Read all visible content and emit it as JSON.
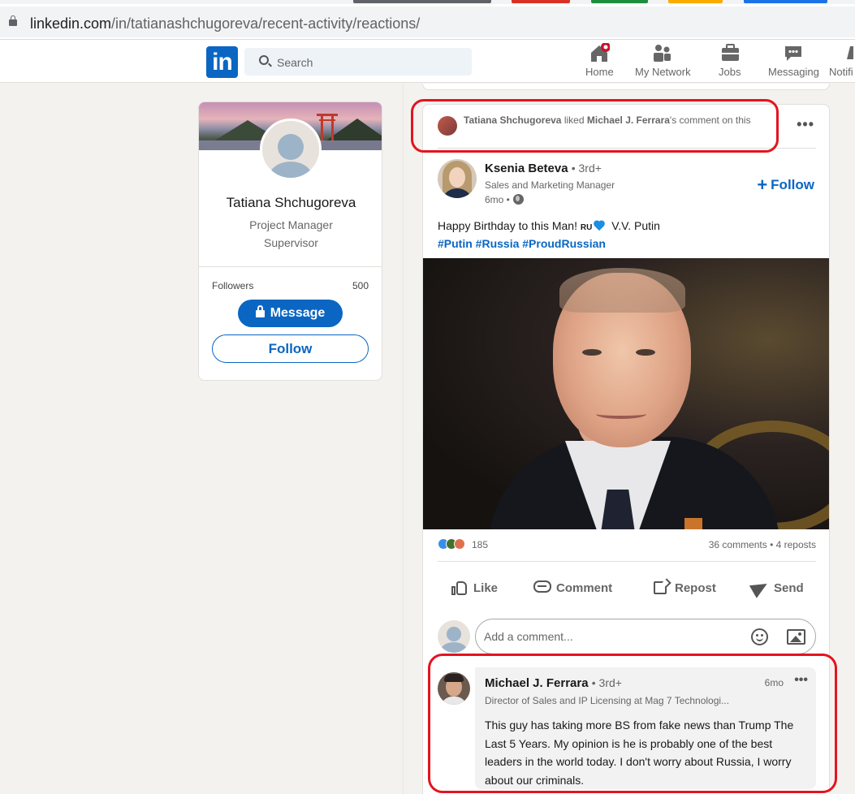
{
  "browser": {
    "url_host": "linkedin.com",
    "url_path": "/in/tatianashchugoreva/recent-activity/reactions/",
    "tab_colors": [
      "#5f6368",
      "#d93025",
      "#1e8e3e",
      "#f9ab00",
      "#1a73e8"
    ]
  },
  "nav": {
    "logo": "in",
    "search_placeholder": "Search",
    "items": [
      {
        "label": "Home",
        "icon": "home-icon"
      },
      {
        "label": "My Network",
        "icon": "network-icon"
      },
      {
        "label": "Jobs",
        "icon": "briefcase-icon"
      },
      {
        "label": "Messaging",
        "icon": "messaging-icon"
      },
      {
        "label": "Notifi",
        "icon": "bell-icon"
      }
    ],
    "accent": "#0a66c2",
    "notification_badge_color": "#cb112d"
  },
  "profile": {
    "name": "Tatiana Shchugoreva",
    "headline_line1": "Project Manager",
    "headline_line2": "Supervisor",
    "followers_label": "Followers",
    "followers_count": "500",
    "message_button": "Message",
    "follow_button": "Follow"
  },
  "activity": {
    "actor": "Tatiana Shchugoreva",
    "verb": "liked",
    "target": "Michael J. Ferrara",
    "suffix": "'s comment on this",
    "more": "•••"
  },
  "post": {
    "author_name": "Ksenia Beteva",
    "author_degree": "• 3rd+",
    "author_headline": "Sales and Marketing Manager",
    "author_time": "6mo •",
    "follow_label": "Follow",
    "text_before": "Happy Birthday to this Man! ",
    "flag": "RU",
    "text_after": " V.V. Putin",
    "hashtags": "#Putin #Russia #ProudRussian",
    "reactions_count": "185",
    "comments_reposts": "36 comments • 4 reposts"
  },
  "actions": {
    "like": "Like",
    "comment": "Comment",
    "repost": "Repost",
    "send": "Send"
  },
  "comment_input": {
    "placeholder": "Add a comment..."
  },
  "comment": {
    "author_name": "Michael J. Ferrara",
    "author_degree": "• 3rd+",
    "time": "6mo",
    "more": "•••",
    "headline": "Director of Sales and IP Licensing at Mag 7 Technologi...",
    "text": "This guy has taking more BS from fake news than Trump The Last 5 Years. My opinion is he is probably one of the best leaders in the world today. I don't worry about Russia, I worry about our criminals."
  },
  "annotation_color": "#e3141f"
}
